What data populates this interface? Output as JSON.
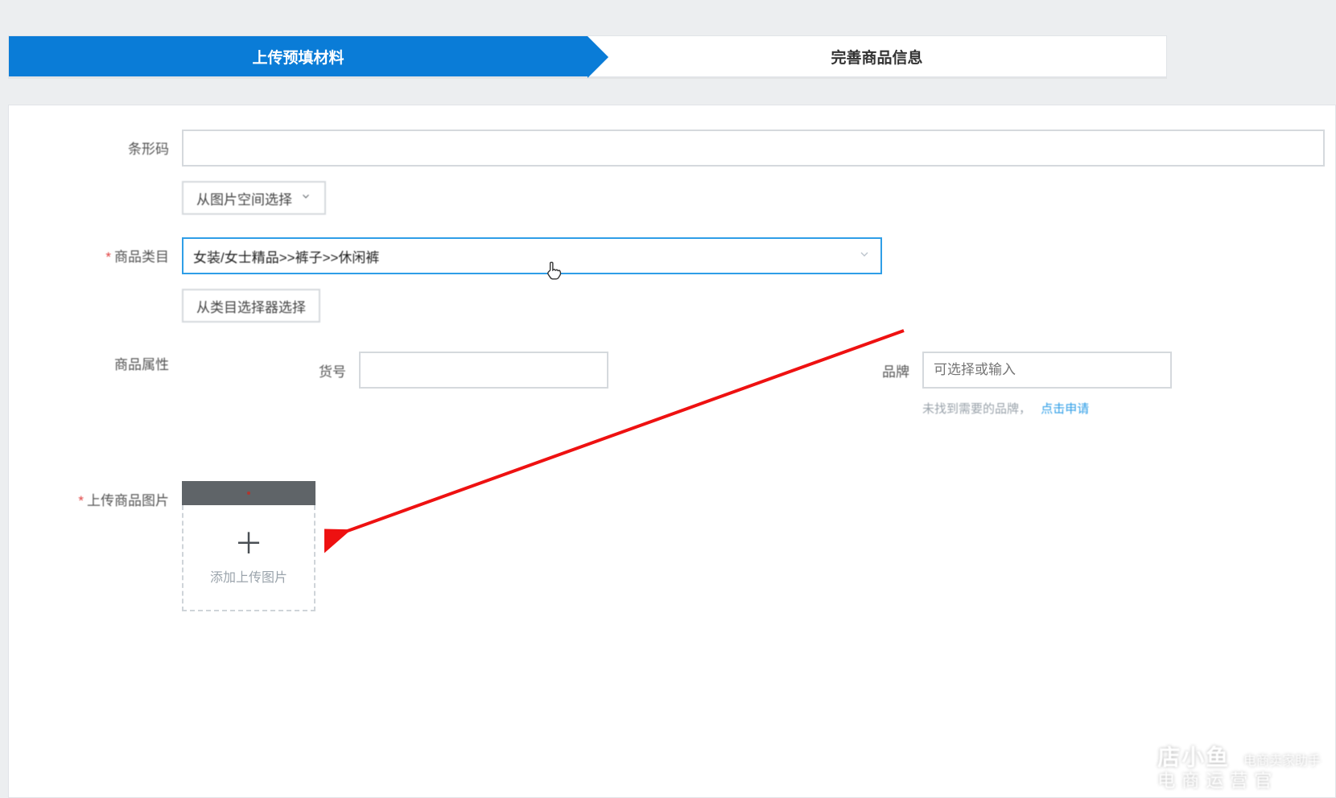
{
  "steps": {
    "active": "上传预填材料",
    "inactive": "完善商品信息"
  },
  "form": {
    "barcode_label": "条形码",
    "barcode_value": "",
    "pick_from_space_btn": "从图片空间选择",
    "category_label": "商品类目",
    "category_value": "女装/女士精品>>裤子>>休闲裤",
    "pick_from_category_btn": "从类目选择器选择",
    "attributes_label": "商品属性",
    "sku_label": "货号",
    "sku_value": "",
    "brand_label": "品牌",
    "brand_placeholder": "可选择或输入",
    "brand_hint_text": "未找到需要的品牌，",
    "brand_hint_link": "点击申请",
    "upload_label": "上传商品图片",
    "upload_add_text": "添加上传图片"
  },
  "watermark": {
    "name": "店小鱼",
    "line1": "电商卖家助手",
    "line2": "电商运营官"
  }
}
